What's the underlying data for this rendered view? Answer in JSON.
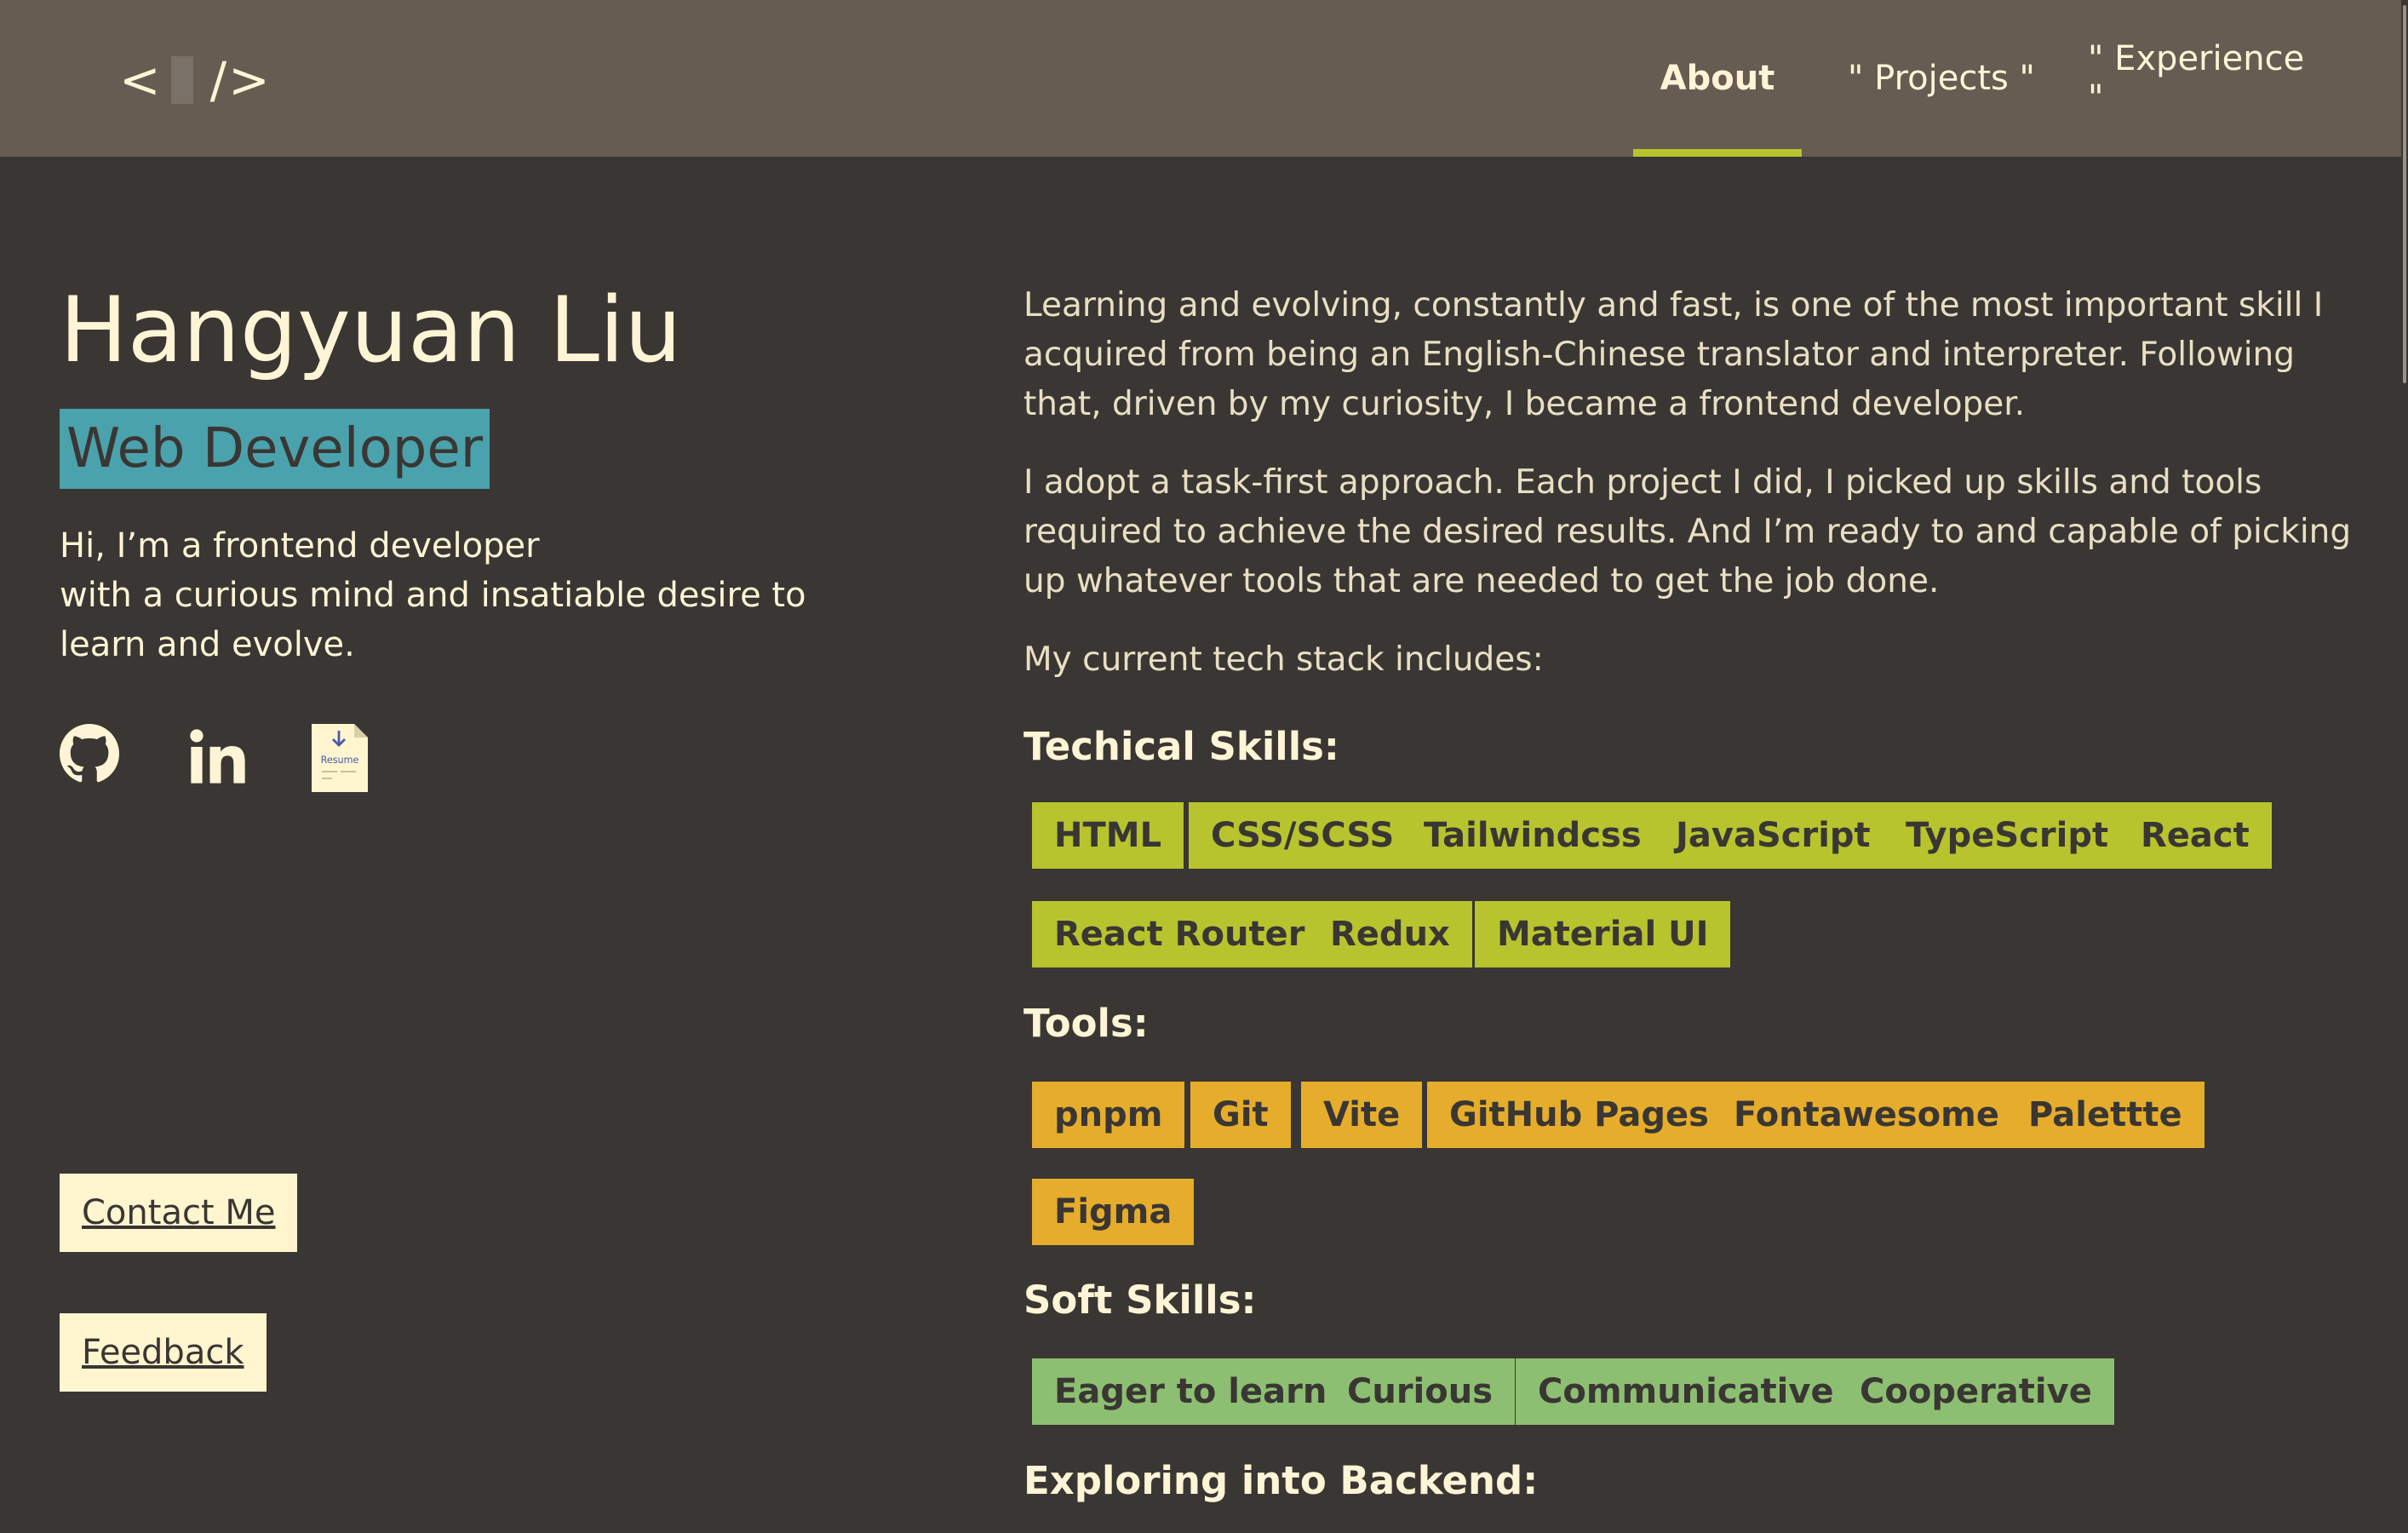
{
  "header": {
    "logo": "</>",
    "nav": [
      {
        "label": "About",
        "active": true
      },
      {
        "label": "\" Projects \"",
        "active": false
      },
      {
        "label": "\" Experience \"",
        "active": false
      }
    ]
  },
  "profile": {
    "name": "Hangyuan Liu",
    "role": "Web Developer",
    "intro_line1": "Hi, I’m a frontend developer",
    "intro_line2": "with a curious mind and insatiable desire to learn and evolve.",
    "socials": [
      "github-icon",
      "linkedin-icon",
      "resume-icon"
    ],
    "resume_icon_text": "Resume",
    "contact_label": "Contact Me",
    "feedback_label": "Feedback"
  },
  "about": {
    "p1": "Learning and evolving, constantly and fast, is one of the most important skill I acquired from being an English-Chinese translator and interpreter. Following that, driven by my curiosity, I became a frontend developer.",
    "p2": "I adopt a task-first approach. Each project I did, I picked up skills and tools required to achieve the desired results. And I’m ready to and capable of picking up whatever tools that are needed to get the job done.",
    "p3": "My current tech stack includes:",
    "technical_title": "Techical Skills:",
    "technical": [
      "HTML",
      "CSS/SCSS",
      "Tailwindcss",
      "JavaScript",
      "TypeScript",
      "React",
      "React Router",
      "Redux",
      "Material UI"
    ],
    "tools_title": "Tools:",
    "tools": [
      "pnpm",
      "Git",
      "Vite",
      "GitHub Pages",
      "Fontawesome",
      "Palettte",
      "Figma"
    ],
    "soft_title": "Soft Skills:",
    "soft": [
      "Eager to learn",
      "Curious",
      "Communicative",
      "Cooperative"
    ],
    "backend_title": "Exploring into Backend:"
  },
  "colors": {
    "background": "#3a3633",
    "header": "#665c52",
    "accent": "#b7c42e",
    "role_bg": "#4aa2ad",
    "tools": "#e5ad2b",
    "soft": "#8dbf72",
    "cream": "#fff5cf"
  }
}
